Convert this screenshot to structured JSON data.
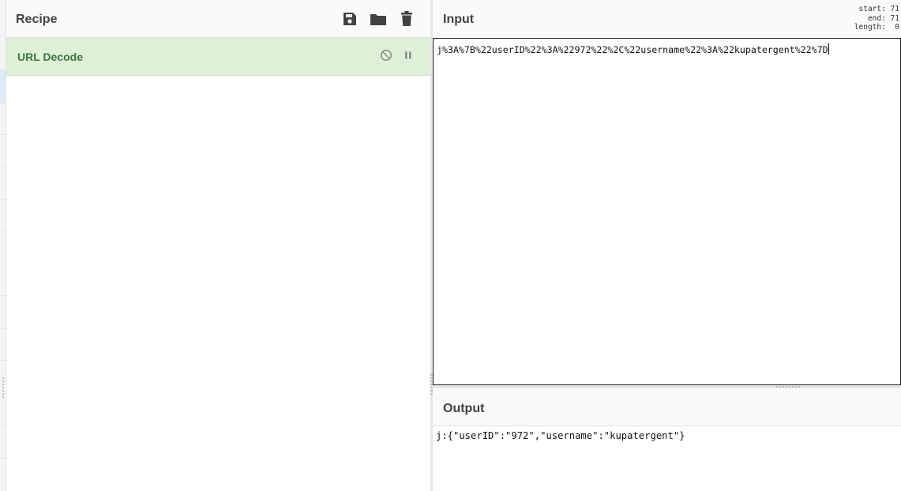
{
  "recipe": {
    "title": "Recipe",
    "icons": [
      "save-icon",
      "folder-icon",
      "trash-icon"
    ],
    "operations": [
      {
        "name": "URL Decode",
        "icons": [
          "disable-icon",
          "pause-icon"
        ]
      }
    ]
  },
  "input": {
    "title": "Input",
    "stats": {
      "start": "start: 71",
      "end": "end: 71",
      "length": "length:  0"
    },
    "value": "j%3A%7B%22userID%22%3A%22972%22%2C%22username%22%3A%22kupatergent%22%7D"
  },
  "output": {
    "title": "Output",
    "value": "j:{\"userID\":\"972\",\"username\":\"kupatergent\"}"
  },
  "colors": {
    "operation_bg": "#dff0d8",
    "operation_text": "#3c763d",
    "header_bg": "#fafafa"
  }
}
